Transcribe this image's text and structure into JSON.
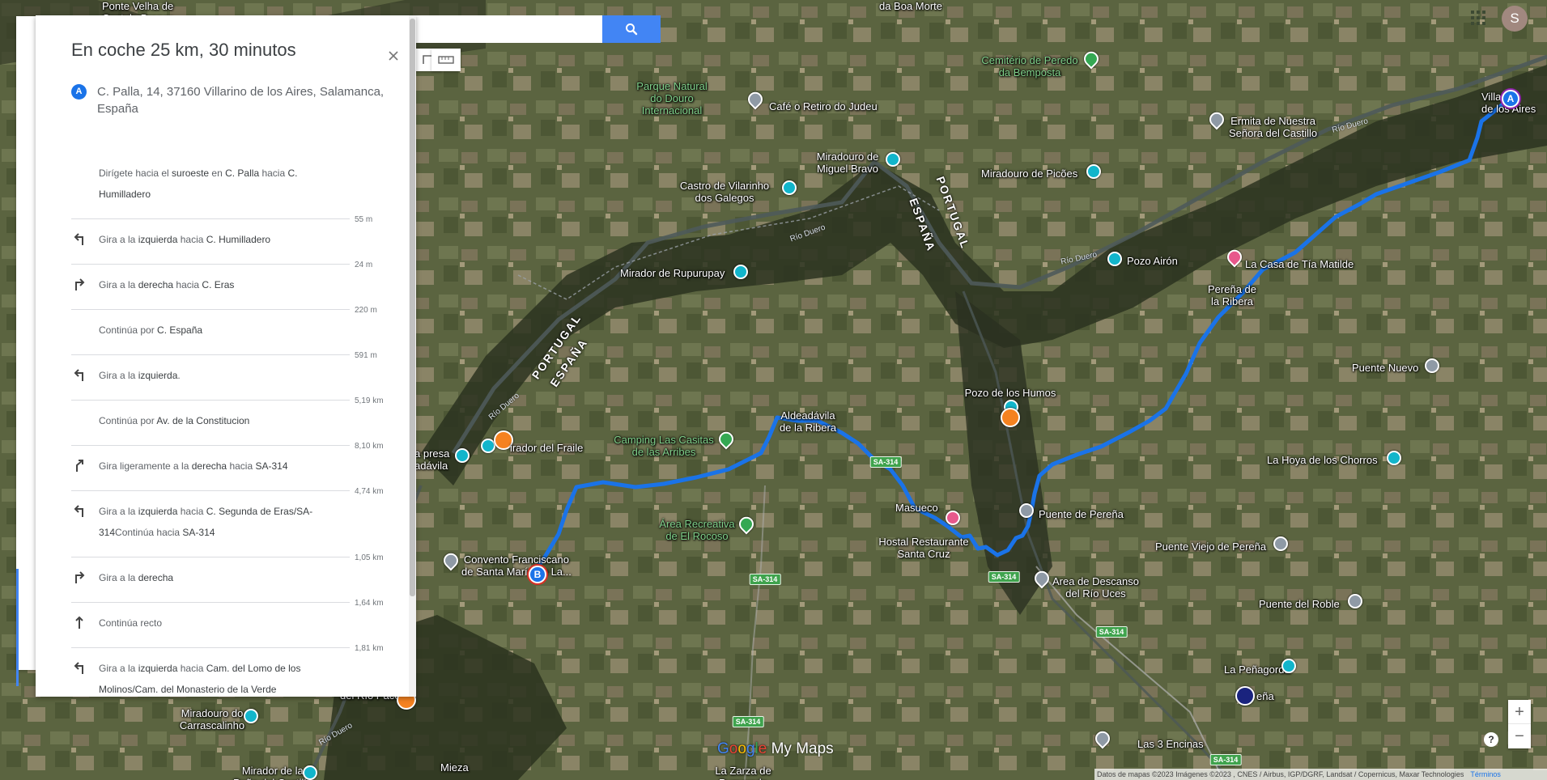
{
  "search": {
    "button_icon": "search-icon"
  },
  "toolbar": {
    "tools": [
      "draw-line-icon",
      "ruler-icon"
    ]
  },
  "account": {
    "avatar_letter": "S",
    "apps_icon": "apps-grid-icon"
  },
  "directions": {
    "title": "En coche 25 km, 30 minutos",
    "origin_badge": "A",
    "origin_address": "C. Palla, 14, 37160 Villarino de los Aires, Salamanca, España",
    "steps": [
      {
        "icon": "none",
        "html": "Dirígete hacia el <b>suroeste</b> en <b>C. Palla</b> hacia <b>C. Humilladero</b>",
        "distance": "55 m"
      },
      {
        "icon": "turn-left-icon",
        "html": "Gira a la <b>izquierda</b> hacia <b>C. Humilladero</b>",
        "distance": "24 m"
      },
      {
        "icon": "turn-right-icon",
        "html": "Gira a la <b>derecha</b> hacia <b>C. Eras</b>",
        "distance": "220 m"
      },
      {
        "icon": "none",
        "html": "Continúa por <b>C. España</b>",
        "distance": "591 m"
      },
      {
        "icon": "turn-left-icon",
        "html": "Gira a la <b>izquierda</b>.",
        "distance": "5,19 km"
      },
      {
        "icon": "none",
        "html": "Continúa por <b>Av. de la Constitucion</b>",
        "distance": "8,10 km"
      },
      {
        "icon": "slight-right-icon",
        "html": "Gira ligeramente a la <b>derecha</b> hacia <b>SA-314</b>",
        "distance": "4,74 km"
      },
      {
        "icon": "turn-left-icon",
        "html": "Gira a la <b>izquierda</b> hacia <b>C. Segunda de Eras/SA-314</b>Continúa hacia <b>SA-314</b>",
        "distance": "1,05 km"
      },
      {
        "icon": "turn-right-icon",
        "html": "Gira a la <b>derecha</b>",
        "distance": "1,64 km"
      },
      {
        "icon": "straight-icon",
        "html": "Continúa recto",
        "distance": "1,81 km"
      },
      {
        "icon": "turn-left-icon",
        "html": "Gira a la <b>izquierda</b> hacia <b>Cam. del Lomo de los Molinos/Cam. del Monasterio de la Verde</b>",
        "distance": ""
      }
    ]
  },
  "map": {
    "route_color": "#1a73e8",
    "markers": {
      "start": "A",
      "end": "B"
    },
    "places": [
      {
        "id": "boa-morte",
        "text": "da Boa Morte",
        "style": ""
      },
      {
        "id": "ponte-velha",
        "text": "Ponte Velha de\nCastelo Branco",
        "style": ""
      },
      {
        "id": "parque-natural",
        "text": "Parque Natural\ndo Douro\nInternacional",
        "style": "green"
      },
      {
        "id": "cafe-retiro",
        "text": "Café o Retiro do Judeu",
        "style": ""
      },
      {
        "id": "cemiterio",
        "text": "Cemitério de Peredo\nda Bemposta",
        "style": "green"
      },
      {
        "id": "ermita",
        "text": "Ermita de Nuestra\nSeñora del Castillo",
        "style": ""
      },
      {
        "id": "villarino",
        "text": "Villarino\nde los Aires",
        "style": ""
      },
      {
        "id": "miradouro-bravo",
        "text": "Miradouro de\nMiguel Bravo",
        "style": ""
      },
      {
        "id": "castro",
        "text": "Castro de Vilarinho\ndos Galegos",
        "style": ""
      },
      {
        "id": "miradouro-picoes",
        "text": "Miradouro de Picões",
        "style": ""
      },
      {
        "id": "rupurupay",
        "text": "Mirador de Rupurupay",
        "style": ""
      },
      {
        "id": "pozo-airon",
        "text": "Pozo Airón",
        "style": ""
      },
      {
        "id": "casa-tia",
        "text": "La Casa de Tía Matilde",
        "style": ""
      },
      {
        "id": "perena",
        "text": "Pereña de\nla Ribera",
        "style": ""
      },
      {
        "id": "puente-nuevo",
        "text": "Puente Nuevo",
        "style": ""
      },
      {
        "id": "pozo-humos",
        "text": "Pozo de los Humos",
        "style": ""
      },
      {
        "id": "aldeadavila",
        "text": "Aldeadávila\nde la Ribera",
        "style": ""
      },
      {
        "id": "camping",
        "text": "Camping Las Casitas\nde las Arribes",
        "style": "green"
      },
      {
        "id": "presa",
        "text": "a presa\nadávila",
        "style": ""
      },
      {
        "id": "fraile",
        "text": "irador del Fraile",
        "style": ""
      },
      {
        "id": "hoya",
        "text": "La Hoya de los Chorros",
        "style": ""
      },
      {
        "id": "masueco",
        "text": "Masueco",
        "style": ""
      },
      {
        "id": "puente-perena",
        "text": "Puente de Pereña",
        "style": ""
      },
      {
        "id": "hostal",
        "text": "Hostal Restaurante\nSanta Cruz",
        "style": ""
      },
      {
        "id": "area-rocoso",
        "text": "Área Recreativa\nde El Rocoso",
        "style": "green"
      },
      {
        "id": "puente-viejo",
        "text": "Puente Viejo de Pereña",
        "style": ""
      },
      {
        "id": "convento",
        "text": "Convento Franciscano\nde Santa María de La...",
        "style": ""
      },
      {
        "id": "area-descanso",
        "text": "Area de Descanso\ndel Río Uces",
        "style": ""
      },
      {
        "id": "puente-roble",
        "text": "Puente del Roble",
        "style": ""
      },
      {
        "id": "penagorda",
        "text": "La Peñagorda",
        "style": ""
      },
      {
        "id": "ena",
        "text": "eña",
        "style": ""
      },
      {
        "id": "carrascalinho",
        "text": "Miradouro do\nCarrascalinho",
        "style": ""
      },
      {
        "id": "rio-paco",
        "text": "del Río Paco",
        "style": ""
      },
      {
        "id": "mirador-la",
        "text": "Mirador de la\nPeña del Castillo",
        "style": ""
      },
      {
        "id": "mieza",
        "text": "Mieza",
        "style": ""
      },
      {
        "id": "zarza",
        "text": "La Zarza de\nPumareda",
        "style": ""
      },
      {
        "id": "encinas",
        "text": "Las 3 Encinas",
        "style": ""
      }
    ],
    "river_labels": [
      "Río Duero",
      "Río Duero",
      "Río Duero",
      "Río Duero",
      "Río Duero"
    ],
    "border_labels": [
      "PORTUGAL",
      "ESPAÑA",
      "ESPAÑA",
      "PORTUGAL"
    ],
    "road_badges": [
      "SA-314",
      "SA-314",
      "SA-314",
      "SA-314",
      "SA-314",
      "SA-314"
    ]
  },
  "controls": {
    "zoom_in": "+",
    "zoom_out": "−",
    "help": "?"
  },
  "brand": {
    "text": "Google My Maps"
  },
  "attribution": {
    "text": "Datos de mapas ©2023 Imágenes ©2023 , CNES / Airbus, IGP/DGRF, Landsat / Copernicus, Maxar Technologies",
    "terms": "Términos"
  }
}
